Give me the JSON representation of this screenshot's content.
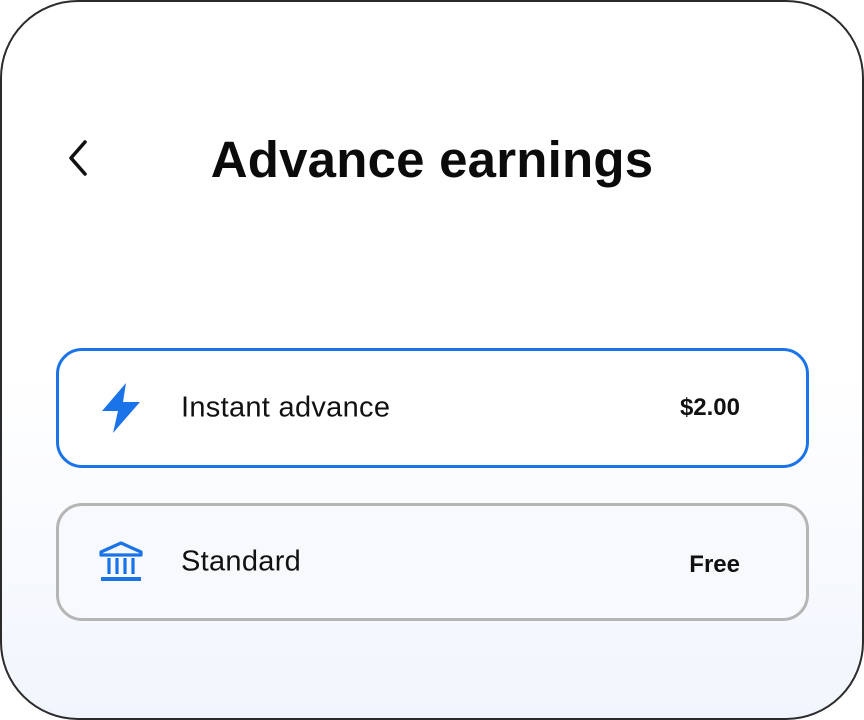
{
  "header": {
    "title": "Advance earnings",
    "back_icon": "chevron-left-icon"
  },
  "options": [
    {
      "label": "Instant advance",
      "price": "$2.00",
      "icon": "lightning-bolt-icon",
      "selected": true
    },
    {
      "label": "Standard",
      "price": "Free",
      "icon": "bank-icon",
      "selected": false
    }
  ],
  "colors": {
    "accent": "#1a73e8",
    "unselected_border": "#b5b5b5",
    "text": "#111111"
  }
}
